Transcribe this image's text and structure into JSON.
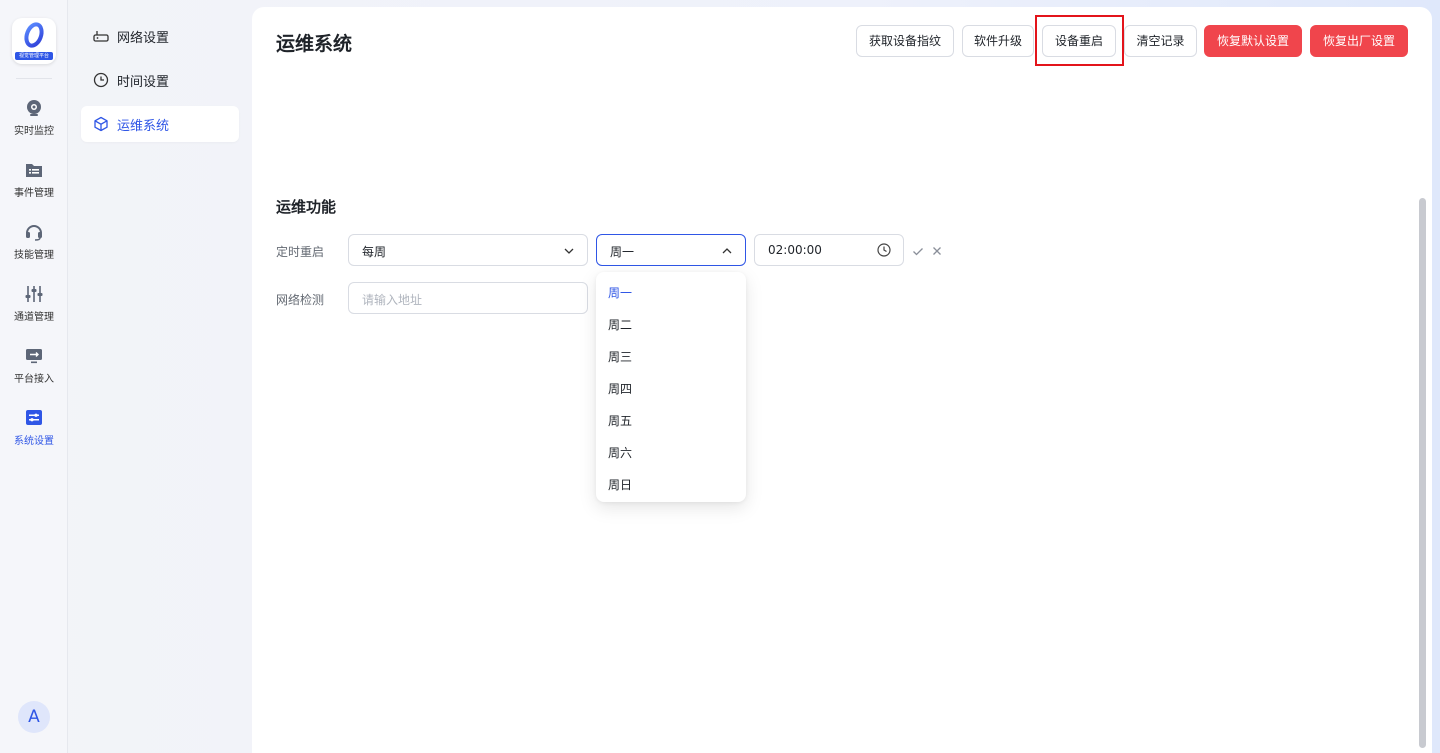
{
  "app": {
    "logo_text": "视觉管理平台",
    "avatar_initial": "A"
  },
  "rail": {
    "items": [
      {
        "label": "实时监控",
        "icon": "camera-icon"
      },
      {
        "label": "事件管理",
        "icon": "folder-list-icon"
      },
      {
        "label": "技能管理",
        "icon": "headset-icon"
      },
      {
        "label": "通道管理",
        "icon": "sliders-icon"
      },
      {
        "label": "平台接入",
        "icon": "monitor-arrows-icon"
      },
      {
        "label": "系统设置",
        "icon": "settings-panel-icon",
        "active": true
      }
    ]
  },
  "submenu": {
    "items": [
      {
        "label": "网络设置",
        "icon": "router-icon"
      },
      {
        "label": "时间设置",
        "icon": "clock-icon"
      },
      {
        "label": "运维系统",
        "icon": "cube-icon",
        "active": true
      }
    ]
  },
  "header": {
    "title": "运维系统",
    "buttons": {
      "fingerprint": "获取设备指纹",
      "upgrade": "软件升级",
      "reboot": "设备重启",
      "clear_logs": "清空记录",
      "restore_default": "恢复默认设置",
      "factory_reset": "恢复出厂设置"
    }
  },
  "ops": {
    "section_title": "运维功能",
    "scheduled_reboot": {
      "label": "定时重启",
      "frequency": "每周",
      "day": "周一",
      "time": "02:00:00"
    },
    "network_check": {
      "label": "网络检测",
      "placeholder": "请输入地址"
    }
  },
  "day_dropdown": {
    "options": [
      "周一",
      "周二",
      "周三",
      "周四",
      "周五",
      "周六",
      "周日"
    ],
    "selected": "周一"
  },
  "colors": {
    "accent": "#2f56e6",
    "danger": "#f0454c",
    "highlight": "#e3141b"
  }
}
